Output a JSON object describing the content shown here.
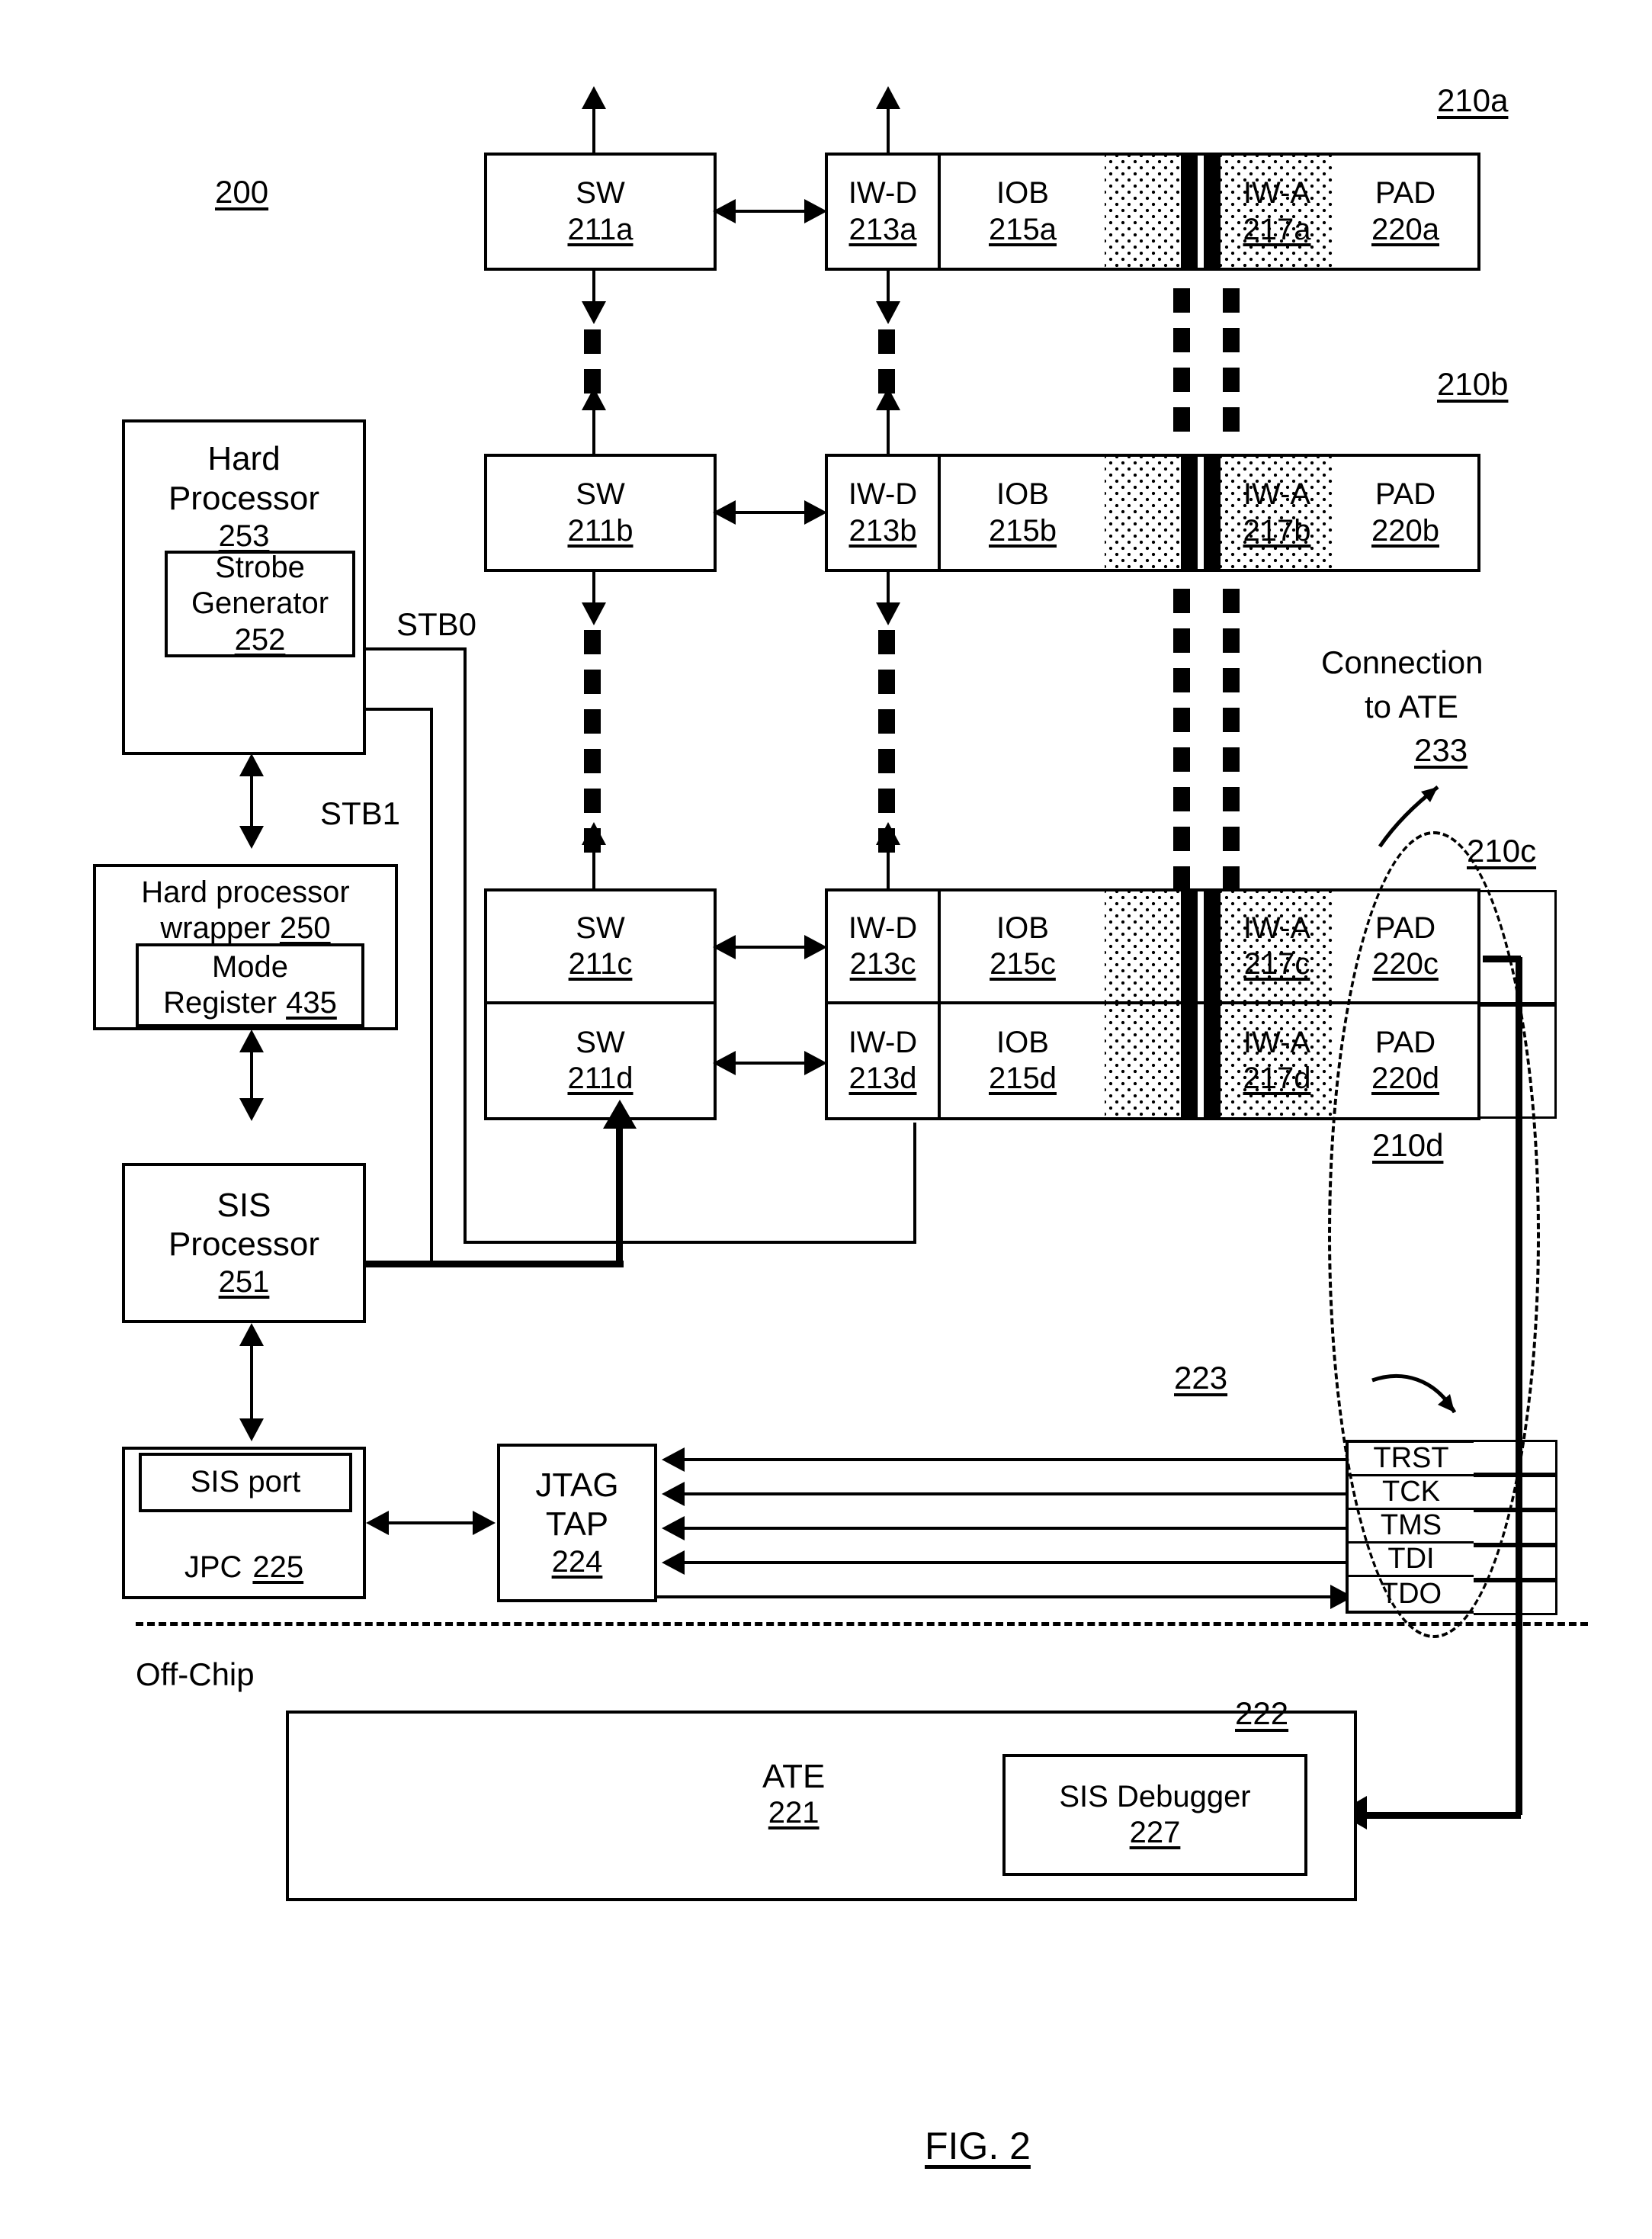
{
  "figure": {
    "caption": "FIG. 2",
    "system_ref": "200",
    "off_chip_label": "Off-Chip"
  },
  "io_rows": [
    {
      "row_ref": "210a",
      "sw": {
        "label": "SW",
        "num": "211a"
      },
      "iwd": {
        "label": "IW-D",
        "num": "213a"
      },
      "iob": {
        "label": "IOB",
        "num": "215a"
      },
      "iwa": {
        "label": "IW-A",
        "num": "217a"
      },
      "pad": {
        "label": "PAD",
        "num": "220a"
      }
    },
    {
      "row_ref": "210b",
      "sw": {
        "label": "SW",
        "num": "211b"
      },
      "iwd": {
        "label": "IW-D",
        "num": "213b"
      },
      "iob": {
        "label": "IOB",
        "num": "215b"
      },
      "iwa": {
        "label": "IW-A",
        "num": "217b"
      },
      "pad": {
        "label": "PAD",
        "num": "220b"
      }
    },
    {
      "row_ref": "210c",
      "sw": {
        "label": "SW",
        "num": "211c"
      },
      "iwd": {
        "label": "IW-D",
        "num": "213c"
      },
      "iob": {
        "label": "IOB",
        "num": "215c"
      },
      "iwa": {
        "label": "IW-A",
        "num": "217c"
      },
      "pad": {
        "label": "PAD",
        "num": "220c"
      }
    },
    {
      "row_ref": "210d",
      "sw": {
        "label": "SW",
        "num": "211d"
      },
      "iwd": {
        "label": "IW-D",
        "num": "213d"
      },
      "iob": {
        "label": "IOB",
        "num": "215d"
      },
      "iwa": {
        "label": "IW-A",
        "num": "217d"
      },
      "pad": {
        "label": "PAD",
        "num": "220d"
      }
    }
  ],
  "hard_processor": {
    "line1": "Hard",
    "line2": "Processor",
    "num": "253",
    "strobe_generator": {
      "line1": "Strobe",
      "line2": "Generator",
      "num": "252"
    }
  },
  "strobe_signals": {
    "stb0": "STB0",
    "stb1": "STB1"
  },
  "hard_processor_wrapper": {
    "line1": "Hard processor",
    "line2": "wrapper",
    "num": "250",
    "mode_register": {
      "line1": "Mode",
      "line2": "Register",
      "num": "435"
    }
  },
  "sis_processor": {
    "line1": "SIS",
    "line2": "Processor",
    "num": "251"
  },
  "jpc": {
    "sis_port": "SIS port",
    "label": "JPC",
    "num": "225"
  },
  "jtag_tap": {
    "line1": "JTAG",
    "line2": "TAP",
    "num": "224"
  },
  "jtag_bus_ref": "223",
  "jtag_signals": [
    "TRST",
    "TCK",
    "TMS",
    "TDI",
    "TDO"
  ],
  "connection_to_ate": {
    "line1": "Connection",
    "line2": "to ATE",
    "num": "233"
  },
  "ate": {
    "label": "ATE",
    "num": "221",
    "debugger_group_ref": "222",
    "sis_debugger": {
      "label": "SIS Debugger",
      "num": "227"
    }
  }
}
